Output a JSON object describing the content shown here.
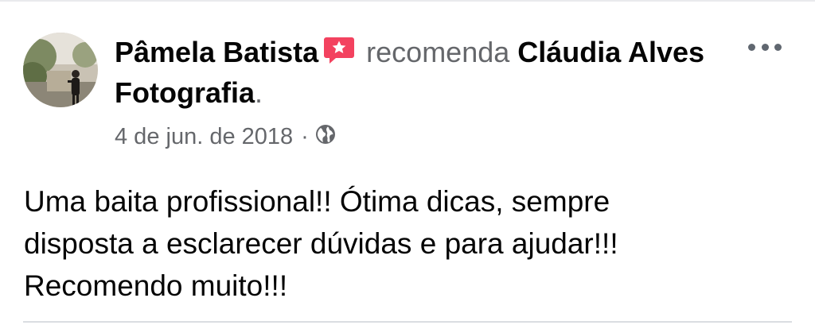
{
  "post": {
    "author": "Pâmela Batista",
    "action": "recomenda",
    "page_name": "Cláudia Alves Fotografia",
    "period": ".",
    "date": "4 de jun. de 2018",
    "separator": "·",
    "audience_icon": "globe-icon",
    "recommend_icon": "recommendation-star-icon",
    "more_icon": "more-options-icon",
    "body": [
      "Uma baita profissional!! Ótima dicas, sempre",
      "disposta a esclarecer dúvidas e para ajudar!!!",
      "Recomendo muito!!!"
    ]
  },
  "colors": {
    "badge": "#f3425f",
    "secondary_text": "#65676b",
    "primary_text": "#050505"
  }
}
